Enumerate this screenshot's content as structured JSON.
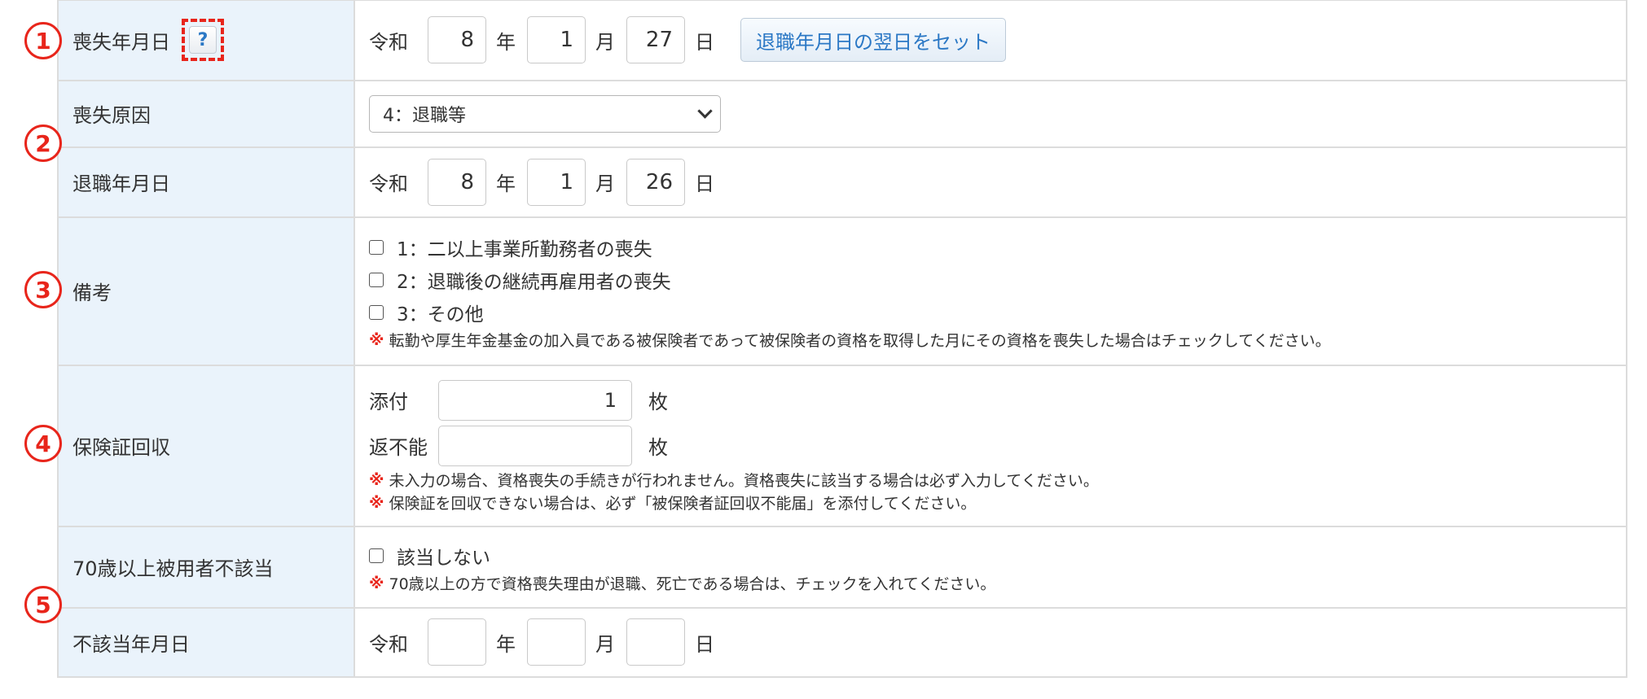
{
  "annotations": [
    "1",
    "2",
    "3",
    "4",
    "5"
  ],
  "loss_date": {
    "label": "喪失年月日",
    "help": "?",
    "era": "令和",
    "year": "8",
    "year_unit": "年",
    "month": "1",
    "month_unit": "月",
    "day": "27",
    "day_unit": "日",
    "set_button": "退職年月日の翌日をセット"
  },
  "loss_reason": {
    "label": "喪失原因",
    "selected": "4：退職等"
  },
  "retirement_date": {
    "label": "退職年月日",
    "era": "令和",
    "year": "8",
    "year_unit": "年",
    "month": "1",
    "month_unit": "月",
    "day": "26",
    "day_unit": "日"
  },
  "remarks": {
    "label": "備考",
    "options": [
      "1：二以上事業所勤務者の喪失",
      "2：退職後の継続再雇用者の喪失",
      "3：その他"
    ],
    "note_mark": "※",
    "note": "転勤や厚生年金基金の加入員である被保険者であって被保険者の資格を取得した月にその資格を喪失した場合はチェックしてください。"
  },
  "insurance_card": {
    "label": "保険証回収",
    "attached_label": "添付",
    "attached_value": "1",
    "attached_unit": "枚",
    "unreturnable_label": "返不能",
    "unreturnable_value": "",
    "unreturnable_unit": "枚",
    "note_mark": "※",
    "notes": [
      "未入力の場合、資格喪失の手続きが行われません。資格喪失に該当する場合は必ず入力してください。",
      "保険証を回収できない場合は、必ず「被保険者証回収不能届」を添付してください。"
    ]
  },
  "over70": {
    "label": "70歳以上被用者不該当",
    "option": "該当しない",
    "note_mark": "※",
    "note": "70歳以上の方で資格喪失理由が退職、死亡である場合は、チェックを入れてください。"
  },
  "non_applicable_date": {
    "label": "不該当年月日",
    "era": "令和",
    "year": "",
    "year_unit": "年",
    "month": "",
    "month_unit": "月",
    "day": "",
    "day_unit": "日"
  },
  "colors": {
    "label_bg": "#eaf3fb",
    "border": "#dcdcdc",
    "accent_red": "#e8251b",
    "link_blue": "#2b78c5"
  }
}
